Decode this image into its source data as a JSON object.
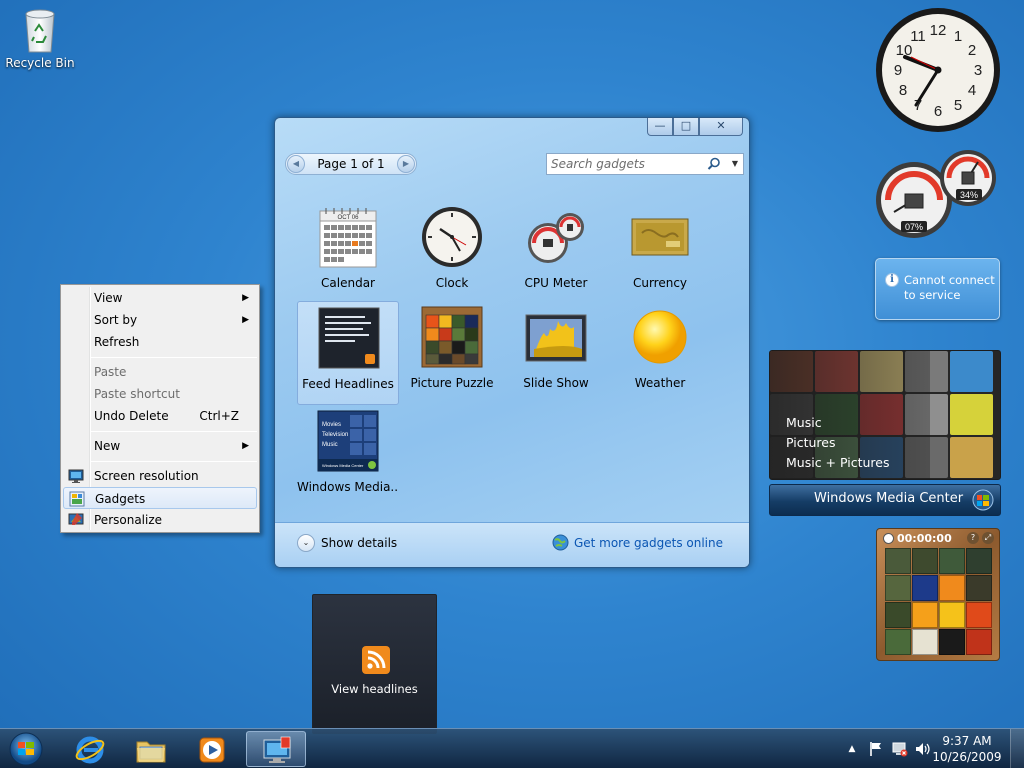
{
  "desktop": {
    "recycle_bin_label": "Recycle Bin"
  },
  "context_menu": {
    "items": [
      {
        "label": "View",
        "submenu": true
      },
      {
        "label": "Sort by",
        "submenu": true
      },
      {
        "label": "Refresh"
      },
      {
        "label": "Paste",
        "disabled": true
      },
      {
        "label": "Paste shortcut",
        "disabled": true
      },
      {
        "label": "Undo Delete",
        "shortcut": "Ctrl+Z"
      },
      {
        "label": "New",
        "submenu": true
      },
      {
        "label": "Screen resolution",
        "icon": "monitor-icon"
      },
      {
        "label": "Gadgets",
        "icon": "gadgets-icon",
        "highlighted": true
      },
      {
        "label": "Personalize",
        "icon": "personalize-icon"
      }
    ]
  },
  "gallery": {
    "controls": {
      "minimize": "—",
      "maximize": "□",
      "close": "✕"
    },
    "pager": {
      "text": "Page 1 of 1",
      "prev": "◀",
      "next": "▶"
    },
    "search": {
      "placeholder": "Search gadgets",
      "dropdown": "▼"
    },
    "gadgets": [
      {
        "label": "Calendar",
        "icon": "calendar-icon",
        "calendar_month": "OCT 06"
      },
      {
        "label": "Clock",
        "icon": "clock-icon"
      },
      {
        "label": "CPU Meter",
        "icon": "cpu-meter-icon"
      },
      {
        "label": "Currency",
        "icon": "currency-icon"
      },
      {
        "label": "Feed Headlines",
        "icon": "feed-headlines-icon",
        "selected": true
      },
      {
        "label": "Picture Puzzle",
        "icon": "picture-puzzle-icon"
      },
      {
        "label": "Slide Show",
        "icon": "slide-show-icon"
      },
      {
        "label": "Weather",
        "icon": "weather-icon"
      },
      {
        "label": "Windows Media...",
        "icon": "windows-media-center-icon",
        "thumb_lines": [
          "Movies",
          "Television",
          "Music"
        ],
        "thumb_footer": "Windows Media Center"
      }
    ],
    "footer": {
      "show_details": "Show details",
      "chevron": "⌄",
      "get_more": "Get more gadgets online"
    }
  },
  "feed_flyout": {
    "label": "View headlines"
  },
  "sidebar": {
    "clock": {
      "numbers": [
        "12",
        "1",
        "2",
        "3",
        "4",
        "5",
        "6",
        "7",
        "8",
        "9",
        "10",
        "11"
      ]
    },
    "cpu_meter": {
      "cpu_percent": "07%",
      "memory_percent": "34%"
    },
    "currency": {
      "message": "Cannot connect to service",
      "info": "i"
    },
    "media_center": {
      "links": [
        "Music",
        "Pictures",
        "Music + Pictures"
      ],
      "title": "Windows Media Center"
    },
    "picture_puzzle": {
      "timer": "00:00:00",
      "help": "?",
      "toggle": "⤢"
    }
  },
  "taskbar": {
    "clock_time": "9:37 AM",
    "clock_date": "10/26/2009",
    "tray_expand": "▲"
  }
}
